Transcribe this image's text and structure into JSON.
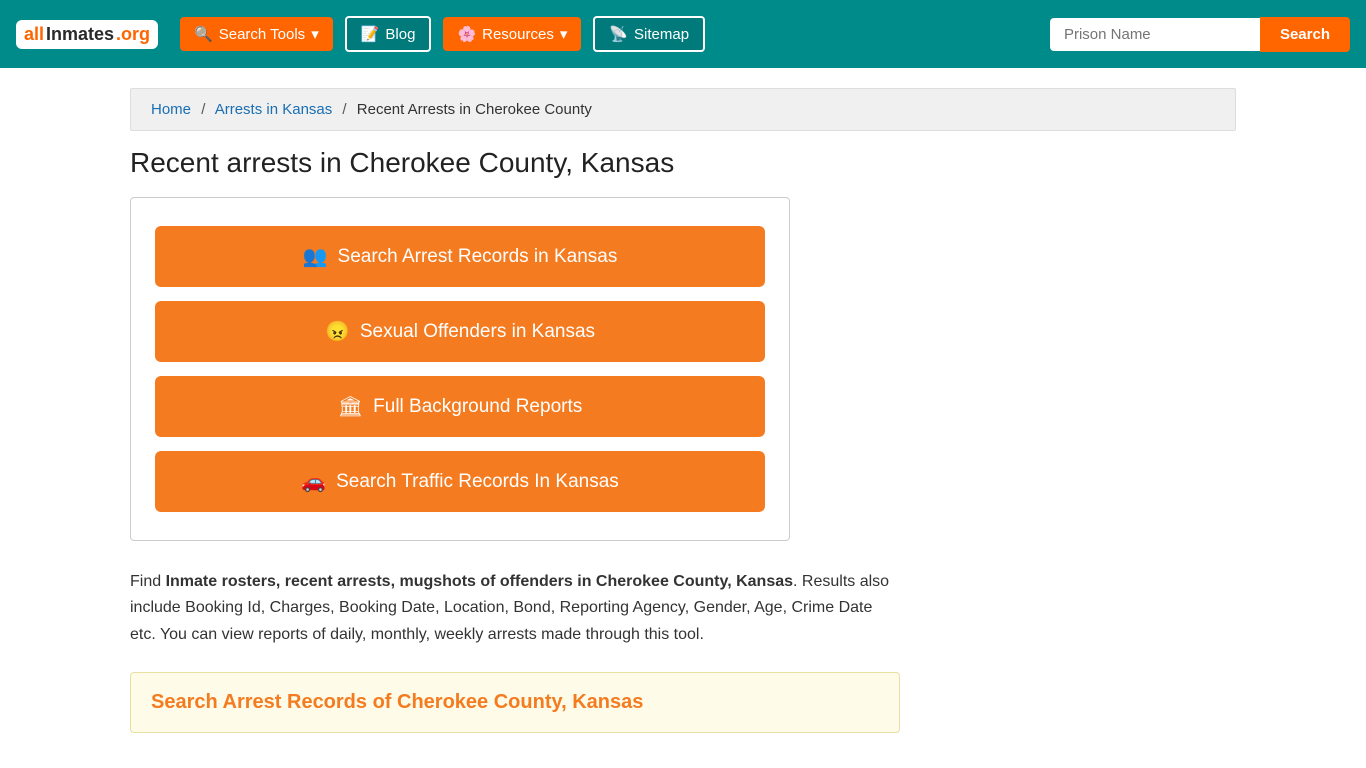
{
  "header": {
    "logo": {
      "all": "all",
      "inmates": "Inmates",
      "org": ".org"
    },
    "nav": {
      "search_tools": "Search Tools",
      "blog": "Blog",
      "resources": "Resources",
      "sitemap": "Sitemap"
    },
    "search": {
      "placeholder": "Prison Name",
      "button": "Search"
    }
  },
  "breadcrumb": {
    "home": "Home",
    "arrests_kansas": "Arrests in Kansas",
    "current": "Recent Arrests in Cherokee County"
  },
  "main": {
    "page_title": "Recent arrests in Cherokee County, Kansas",
    "buttons": [
      {
        "id": "arrest",
        "icon": "👥",
        "label": "Search Arrest Records in Kansas"
      },
      {
        "id": "offenders",
        "icon": "😠",
        "label": "Sexual Offenders in Kansas"
      },
      {
        "id": "background",
        "icon": "🏛",
        "label": "Full Background Reports"
      },
      {
        "id": "traffic",
        "icon": "🚗",
        "label": "Search Traffic Records In Kansas"
      }
    ],
    "description_prefix": "Find ",
    "description_bold": "Inmate rosters, recent arrests, mugshots of offenders in Cherokee County, Kansas",
    "description_suffix": ". Results also include Booking Id, Charges, Booking Date, Location, Bond, Reporting Agency, Gender, Age, Crime Date etc. You can view reports of daily, monthly, weekly arrests made through this tool.",
    "arrest_search_title": "Search Arrest Records of Cherokee County, Kansas"
  }
}
